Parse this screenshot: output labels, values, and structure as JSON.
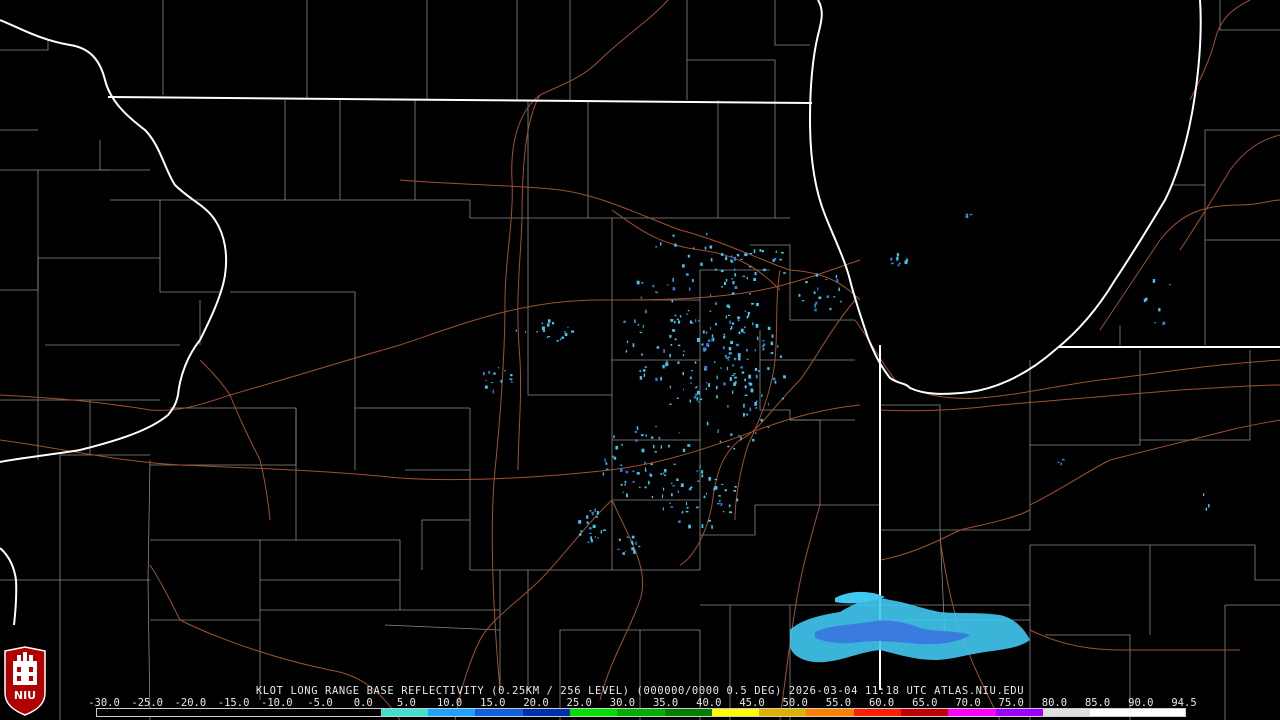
{
  "product_title": "KLOT LONG RANGE BASE REFLECTIVITY (0.25KM / 256 LEVEL) (000000/0000 0.5 DEG) 2026-03-04 11:18 UTC  ATLAS.NIU.EDU",
  "logo_text": "NIU",
  "colors": {
    "background": "#000000",
    "state_borders": "#ffffff",
    "county_lines": "#8a8a8a",
    "highways": "#a0522d",
    "echo_light": "#40c8f0",
    "echo_medium": "#3a7be0"
  },
  "color_scale": {
    "labels": [
      "-30.0",
      "-25.0",
      "-20.0",
      "-15.0",
      "-10.0",
      "-5.0",
      "0.0",
      "5.0",
      "10.0",
      "15.0",
      "20.0",
      "25.0",
      "30.0",
      "35.0",
      "40.0",
      "45.0",
      "50.0",
      "55.0",
      "60.0",
      "65.0",
      "70.0",
      "75.0",
      "80.0",
      "85.0",
      "90.0",
      "94.5"
    ],
    "bin_colors": [
      "#000000",
      "#000000",
      "#000000",
      "#000000",
      "#000000",
      "#000000",
      "#40e0d0",
      "#20a0ff",
      "#1060e0",
      "#0030b0",
      "#00e000",
      "#00b000",
      "#008000",
      "#ffff00",
      "#e0b000",
      "#ff8000",
      "#ff2000",
      "#c00000",
      "#ff00ff",
      "#a000ff",
      "#e0e0e0",
      "#ffffff",
      "#ffffff"
    ]
  }
}
